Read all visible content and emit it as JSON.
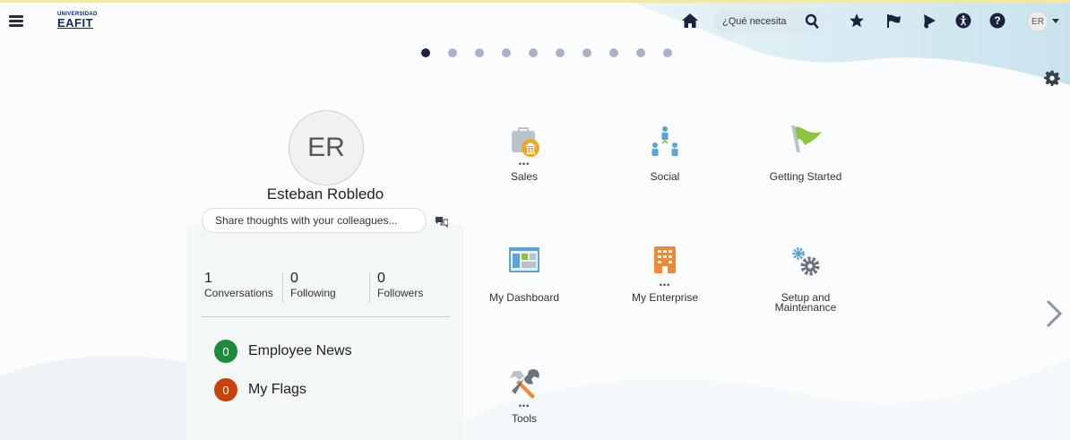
{
  "header": {
    "logo": {
      "line1": "UNIVERSIDAD",
      "line2": "EAFIT"
    },
    "search_placeholder": "¿Qué necesita",
    "user_initials": "ER",
    "icons": [
      "menu-icon",
      "home-icon",
      "search-icon",
      "favorites-star-icon",
      "watchlist-flag-icon",
      "notifications-bell-icon",
      "accessibility-icon",
      "help-icon"
    ]
  },
  "carousel": {
    "pages": 10,
    "active": 0
  },
  "profile": {
    "initials": "ER",
    "name": "Esteban Robledo",
    "share_placeholder": "Share thoughts with your colleagues...",
    "stats": [
      {
        "count": "1",
        "label": "Conversations"
      },
      {
        "count": "0",
        "label": "Following"
      },
      {
        "count": "0",
        "label": "Followers"
      }
    ],
    "feeds": [
      {
        "count": "0",
        "label": "Employee News",
        "color": "#1d8a3c"
      },
      {
        "count": "0",
        "label": "My Flags",
        "color": "#c8430b"
      }
    ]
  },
  "tiles": [
    {
      "label": "Sales"
    },
    {
      "label": "Social"
    },
    {
      "label": "Getting Started"
    },
    {
      "label": "My Dashboard"
    },
    {
      "label": "My Enterprise"
    },
    {
      "label_line1": "Setup and",
      "label_line2": "Maintenance"
    },
    {
      "label": "Tools"
    }
  ],
  "colors": {
    "navy": "#1c2140",
    "dot_inactive": "#aab3c6",
    "accent_green": "#8cc63f",
    "accent_orange": "#f0883a",
    "accent_blue": "#5aa4d6"
  }
}
